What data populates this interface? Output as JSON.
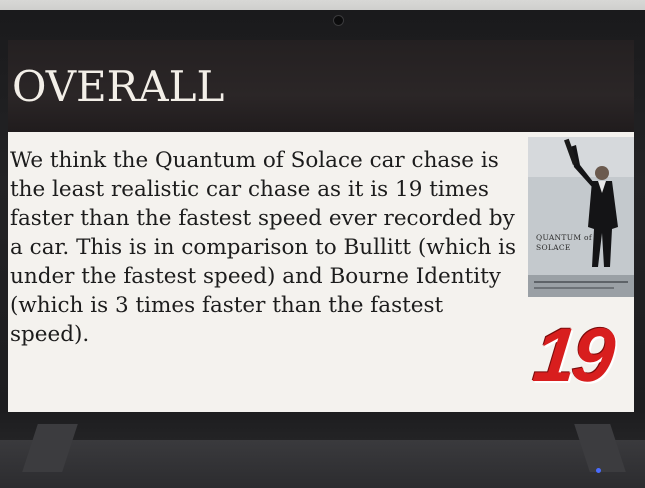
{
  "slide": {
    "title": "OVERALL",
    "body": "We think the Quantum of Solace car chase is the least realistic car chase as it is 19 times faster than the fastest speed ever recorded by a car. This is in comparison to Bullitt (which is under the fastest speed) and Bourne Identity (which is 3 times faster than the fastest speed).",
    "badge_number": "19"
  },
  "poster": {
    "title": "QUANTUM of SOLACE"
  },
  "colors": {
    "title_band": "#242021",
    "slide_background": "#f4f2ee",
    "badge": "#d81e1e",
    "bezel": "#1c1c1e"
  }
}
